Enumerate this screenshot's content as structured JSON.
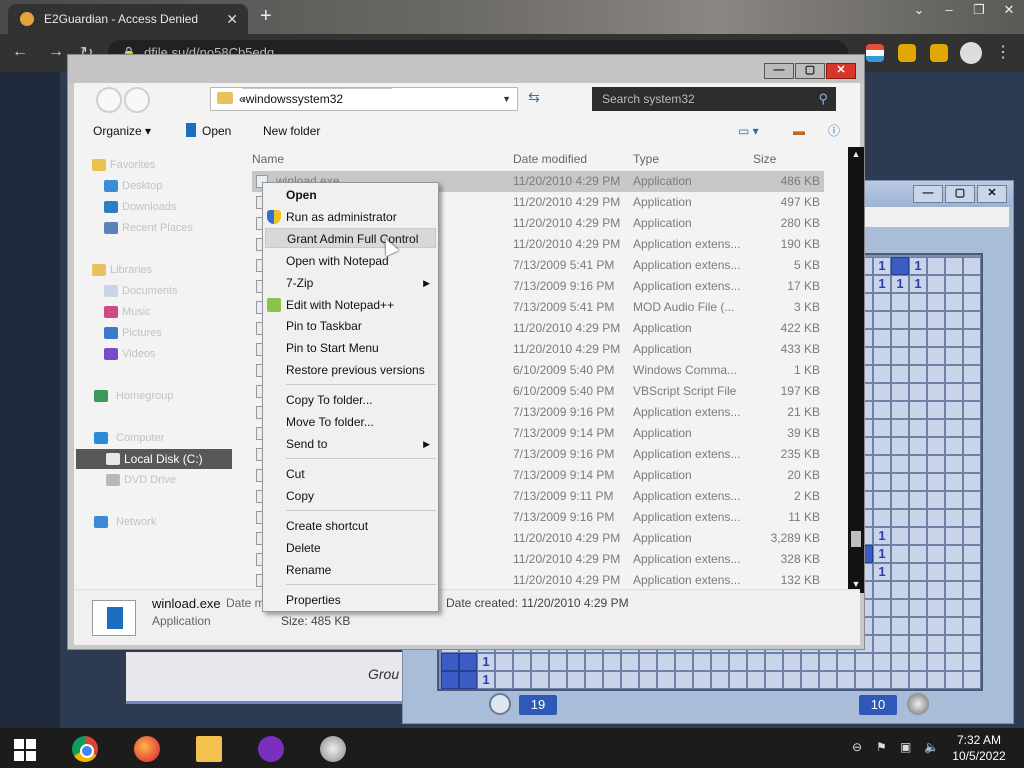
{
  "browser": {
    "tab_title": "E2Guardian - Access Denied",
    "new_tab": "+",
    "address": "dfile.su/d/no58Cb5edq"
  },
  "page": {
    "footer_fragment": "Grou"
  },
  "explorer": {
    "breadcrumb": [
      "«",
      "windows",
      "system32"
    ],
    "search_placeholder": "Search system32",
    "toolbar": {
      "organize": "Organize ▾",
      "open": "Open",
      "new_folder": "New folder"
    },
    "nav": {
      "favorites": "Favorites",
      "desktop": "Desktop",
      "downloads": "Downloads",
      "recent": "Recent Places",
      "libraries": "Libraries",
      "documents": "Documents",
      "music": "Music",
      "pictures": "Pictures",
      "videos": "Videos",
      "homegroup": "Homegroup",
      "computer": "Computer",
      "local_disk": "Local Disk (C:)",
      "dvd": "DVD Drive",
      "network": "Network"
    },
    "columns": {
      "name": "Name",
      "date": "Date modified",
      "type": "Type",
      "size": "Size"
    },
    "files": [
      {
        "name": "winload.exe",
        "date": "11/20/2010 4:29 PM",
        "type": "Application",
        "size": "486 KB"
      },
      {
        "name": "",
        "date": "11/20/2010 4:29 PM",
        "type": "Application",
        "size": "497 KB"
      },
      {
        "name": "",
        "date": "11/20/2010 4:29 PM",
        "type": "Application",
        "size": "280 KB"
      },
      {
        "name": "",
        "date": "11/20/2010 4:29 PM",
        "type": "Application extens...",
        "size": "190 KB"
      },
      {
        "name": "",
        "date": "7/13/2009 5:41 PM",
        "type": "Application extens...",
        "size": "5 KB"
      },
      {
        "name": "",
        "date": "7/13/2009 9:16 PM",
        "type": "Application extens...",
        "size": "17 KB"
      },
      {
        "name": "",
        "date": "7/13/2009 5:41 PM",
        "type": "MOD Audio File (...",
        "size": "3 KB"
      },
      {
        "name": "",
        "date": "11/20/2010 4:29 PM",
        "type": "Application",
        "size": "422 KB"
      },
      {
        "name": "",
        "date": "11/20/2010 4:29 PM",
        "type": "Application",
        "size": "433 KB"
      },
      {
        "name": "",
        "date": "6/10/2009 5:40 PM",
        "type": "Windows Comma...",
        "size": "1 KB"
      },
      {
        "name": "",
        "date": "6/10/2009 5:40 PM",
        "type": "VBScript Script File",
        "size": "197 KB"
      },
      {
        "name": "",
        "date": "7/13/2009 9:16 PM",
        "type": "Application extens...",
        "size": "21 KB"
      },
      {
        "name": "",
        "date": "7/13/2009 9:14 PM",
        "type": "Application",
        "size": "39 KB"
      },
      {
        "name": "",
        "date": "7/13/2009 9:16 PM",
        "type": "Application extens...",
        "size": "235 KB"
      },
      {
        "name": "",
        "date": "7/13/2009 9:14 PM",
        "type": "Application",
        "size": "20 KB"
      },
      {
        "name": "",
        "date": "7/13/2009 9:11 PM",
        "type": "Application extens...",
        "size": "2 KB"
      },
      {
        "name": "",
        "date": "7/13/2009 9:16 PM",
        "type": "Application extens...",
        "size": "11 KB"
      },
      {
        "name": "",
        "date": "11/20/2010 4:29 PM",
        "type": "Application",
        "size": "3,289 KB"
      },
      {
        "name": "",
        "date": "11/20/2010 4:29 PM",
        "type": "Application extens...",
        "size": "328 KB"
      },
      {
        "name": "",
        "date": "11/20/2010 4:29 PM",
        "type": "Application extens...",
        "size": "132 KB"
      }
    ],
    "status": {
      "filename": "winload.exe",
      "filetype": "Application",
      "date_modified_label": "Date m",
      "date_created": "Date created:  11/20/2010 4:29 PM",
      "size": "Size:  485 KB"
    }
  },
  "context_menu": {
    "open": "Open",
    "run_admin": "Run as administrator",
    "grant_admin": "Grant Admin Full Control",
    "open_notepad": "Open with Notepad",
    "sevenzip": "7-Zip",
    "edit_npp": "Edit with Notepad++",
    "pin_taskbar": "Pin to Taskbar",
    "pin_start": "Pin to Start Menu",
    "restore": "Restore previous versions",
    "copy_to": "Copy To folder...",
    "move_to": "Move To folder...",
    "send_to": "Send to",
    "cut": "Cut",
    "copy": "Copy",
    "create_shortcut": "Create shortcut",
    "delete": "Delete",
    "rename": "Rename",
    "properties": "Properties"
  },
  "minesweeper": {
    "timer": "19",
    "mines": "10"
  },
  "taskbar": {
    "time": "7:32 AM",
    "date": "10/5/2022"
  }
}
